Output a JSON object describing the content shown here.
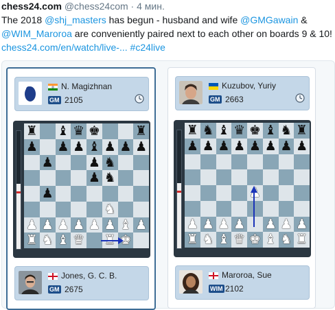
{
  "tweet": {
    "author": "chess24.com",
    "handle": "@chess24com",
    "dot": "·",
    "time": "4 мин.",
    "text_1": "The 2018 ",
    "mention_1": "@shj_masters",
    "text_2": " has begun - husband and wife ",
    "mention_2": "@GMGawain",
    "text_3": " &",
    "mention_3": "@WIM_Maroroa",
    "text_4": " are conveniently paired next to each other on boards 9 & 10!",
    "link": "chess24.com/en/watch/live-...",
    "hashtag": "#c24live"
  },
  "boards": [
    {
      "top_player": {
        "name": "N. Magizhnan",
        "title": "GM",
        "rating": "2105",
        "flag": "india-flag-icon"
      },
      "bottom_player": {
        "name": "Jones, G. C. B.",
        "title": "GM",
        "rating": "2675",
        "flag": "england-flag-icon"
      },
      "rows": [
        "r.bqk..r",
        "p.ppbppp",
        ".p..pn..",
        "....pn..",
        ".p......",
        ".....N..",
        "PPPPPPBP",
        "RNBQ.RK."
      ],
      "eval_white_fraction": 0.55
    },
    {
      "top_player": {
        "name": "Kuzubov, Yuriy",
        "title": "GM",
        "rating": "2663",
        "flag": "ukraine-flag-icon"
      },
      "bottom_player": {
        "name": "Maroroa, Sue",
        "title": "WIM",
        "rating": "2102",
        "flag": "england-flag-icon"
      },
      "rows": [
        "rnbqkbnr",
        "pppppppp",
        "........",
        "........",
        "....P...",
        "........",
        "PPPP.PPP",
        "RNBQKBNR"
      ],
      "eval_white_fraction": 0.55
    }
  ],
  "colors": {
    "link": "#1b95e0",
    "board_light": "#dee5ea",
    "board_dark": "#89a6b6",
    "arrow": "#1a33b8",
    "badge": "#1d4e8a"
  }
}
